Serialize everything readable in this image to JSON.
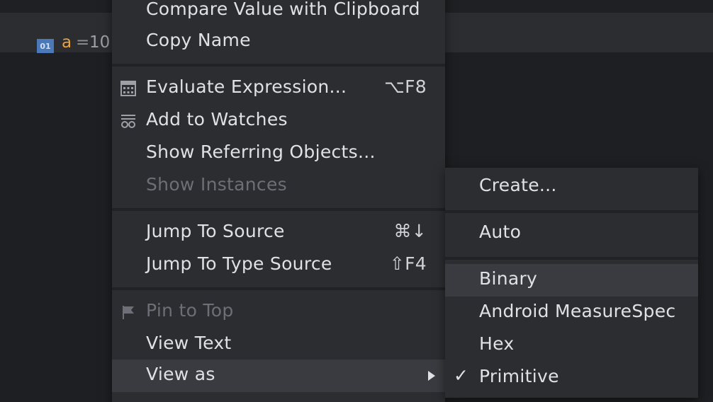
{
  "tree": {
    "variable": {
      "type_icon": "01",
      "name": "a",
      "equals": "=",
      "value": "10"
    }
  },
  "menu": {
    "items": [
      {
        "label": "Compare Value with Clipboard",
        "shortcut": "",
        "icon": "",
        "disabled": false
      },
      {
        "label": "Copy Name",
        "shortcut": "",
        "icon": "",
        "disabled": false
      },
      {
        "label": "Evaluate Expression...",
        "shortcut": "⌥F8",
        "icon": "calculator-icon",
        "disabled": false
      },
      {
        "label": "Add to Watches",
        "shortcut": "",
        "icon": "watches-icon",
        "disabled": false
      },
      {
        "label": "Show Referring Objects...",
        "shortcut": "",
        "icon": "",
        "disabled": false
      },
      {
        "label": "Show Instances",
        "shortcut": "",
        "icon": "",
        "disabled": true
      },
      {
        "label": "Jump To Source",
        "shortcut": "⌘↓",
        "icon": "",
        "disabled": false
      },
      {
        "label": "Jump To Type Source",
        "shortcut": "⇧F4",
        "icon": "",
        "disabled": false
      },
      {
        "label": "Pin to Top",
        "shortcut": "",
        "icon": "flag-icon",
        "disabled": true
      },
      {
        "label": "View Text",
        "shortcut": "",
        "icon": "",
        "disabled": false
      },
      {
        "label": "View as",
        "shortcut": "",
        "icon": "",
        "disabled": false,
        "highlighted": true,
        "submenu": true
      }
    ]
  },
  "submenu": {
    "items": [
      {
        "label": "Create...",
        "checked": false
      },
      {
        "label": "Auto",
        "checked": false
      },
      {
        "label": "Binary",
        "checked": false,
        "highlighted": true
      },
      {
        "label": "Android MeasureSpec",
        "checked": false
      },
      {
        "label": "Hex",
        "checked": false
      },
      {
        "label": "Primitive",
        "checked": true
      }
    ]
  },
  "colors": {
    "background": "#1e1f22",
    "menu_bg": "#2b2d30",
    "highlight": "#393b40",
    "variable_name": "#e8a33d",
    "type_icon": "#4a78b8",
    "disabled_text": "#6c6f75"
  }
}
